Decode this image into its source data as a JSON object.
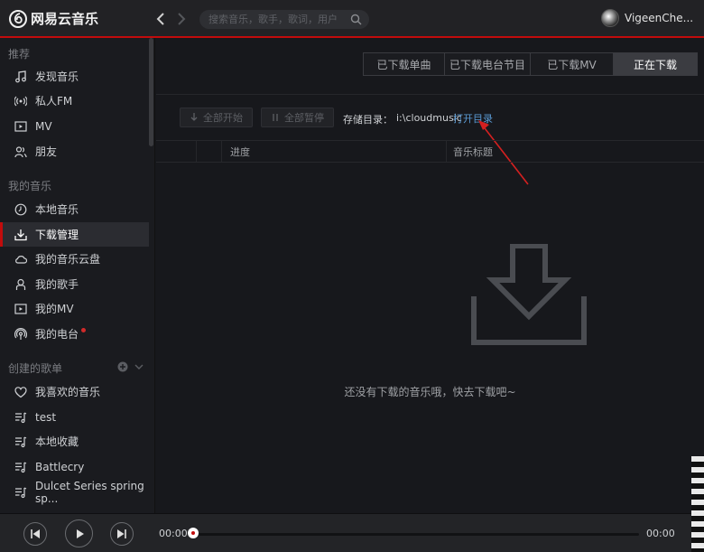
{
  "app": {
    "title": "网易云音乐"
  },
  "search": {
    "placeholder": "搜索音乐，歌手，歌词，用户"
  },
  "user": {
    "name": "VigeenChe..."
  },
  "sidebar": {
    "recommend_title": "推荐",
    "recommend_items": [
      {
        "label": "发现音乐",
        "icon": "music-note-icon"
      },
      {
        "label": "私人FM",
        "icon": "radio-icon"
      },
      {
        "label": "MV",
        "icon": "video-icon"
      },
      {
        "label": "朋友",
        "icon": "friends-icon"
      }
    ],
    "my_music_title": "我的音乐",
    "my_music_items": [
      {
        "label": "本地音乐",
        "icon": "clock-icon"
      },
      {
        "label": "下载管理",
        "icon": "download-icon",
        "active": true
      },
      {
        "label": "我的音乐云盘",
        "icon": "cloud-icon"
      },
      {
        "label": "我的歌手",
        "icon": "singer-icon"
      },
      {
        "label": "我的MV",
        "icon": "video-icon"
      },
      {
        "label": "我的电台",
        "icon": "podcast-icon",
        "badge": true
      }
    ],
    "playlists_title": "创建的歌单",
    "playlist_items": [
      {
        "label": "我喜欢的音乐",
        "icon": "heart-icon"
      },
      {
        "label": "test",
        "icon": "playlist-icon"
      },
      {
        "label": "本地收藏",
        "icon": "playlist-icon"
      },
      {
        "label": "Battlecry",
        "icon": "playlist-icon"
      },
      {
        "label": "Dulcet Series spring sp...",
        "icon": "playlist-icon"
      }
    ]
  },
  "tabs": [
    {
      "label": "已下载单曲"
    },
    {
      "label": "已下载电台节目"
    },
    {
      "label": "已下载MV"
    },
    {
      "label": "正在下载",
      "active": true
    }
  ],
  "toolbar": {
    "start_all": "全部开始",
    "pause_all": "全部暂停",
    "storage_label": "存储目录：",
    "storage_path": "i:\\cloudmusic",
    "open_dir": "打开目录"
  },
  "table": {
    "columns": [
      "进度",
      "音乐标题"
    ]
  },
  "empty": {
    "message": "还没有下载的音乐哦，快去下载吧~"
  },
  "player": {
    "current_time": "00:00",
    "total_time": "00:00",
    "progress": 0
  },
  "colors": {
    "accent": "#c20c0c",
    "link": "#5b9bd5",
    "annotation": "#d42020"
  }
}
